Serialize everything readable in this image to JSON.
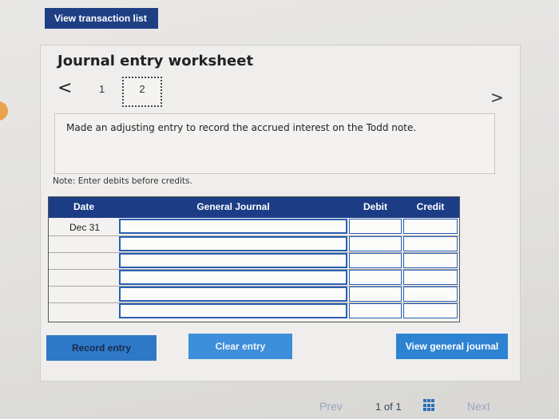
{
  "top_bar": {
    "view_transactions_label": "View transaction list"
  },
  "worksheet": {
    "title": "Journal entry worksheet",
    "nav": {
      "prev_symbol": "<",
      "next_symbol": ">"
    },
    "steps": [
      "1",
      "2"
    ],
    "current_step": "2",
    "instruction": "Made an adjusting entry to record the accrued interest on the Todd note.",
    "note": "Note: Enter debits before credits."
  },
  "journal": {
    "headers": {
      "date": "Date",
      "account": "General Journal",
      "debit": "Debit",
      "credit": "Credit"
    },
    "rows": [
      {
        "date": "Dec 31",
        "account": "",
        "debit": "",
        "credit": ""
      },
      {
        "date": "",
        "account": "",
        "debit": "",
        "credit": ""
      },
      {
        "date": "",
        "account": "",
        "debit": "",
        "credit": ""
      },
      {
        "date": "",
        "account": "",
        "debit": "",
        "credit": ""
      },
      {
        "date": "",
        "account": "",
        "debit": "",
        "credit": ""
      },
      {
        "date": "",
        "account": "",
        "debit": "",
        "credit": ""
      }
    ]
  },
  "actions": {
    "record_label": "Record entry",
    "clear_label": "Clear entry",
    "view_journal_label": "View general journal"
  },
  "pager": {
    "prev_label": "Prev",
    "current": "1",
    "of_label": "of",
    "total": "1",
    "next_label": "Next"
  },
  "colors": {
    "accent": "#1f3f84",
    "button_blue": "#3e8fdb",
    "input_border": "#2a5fb4"
  }
}
